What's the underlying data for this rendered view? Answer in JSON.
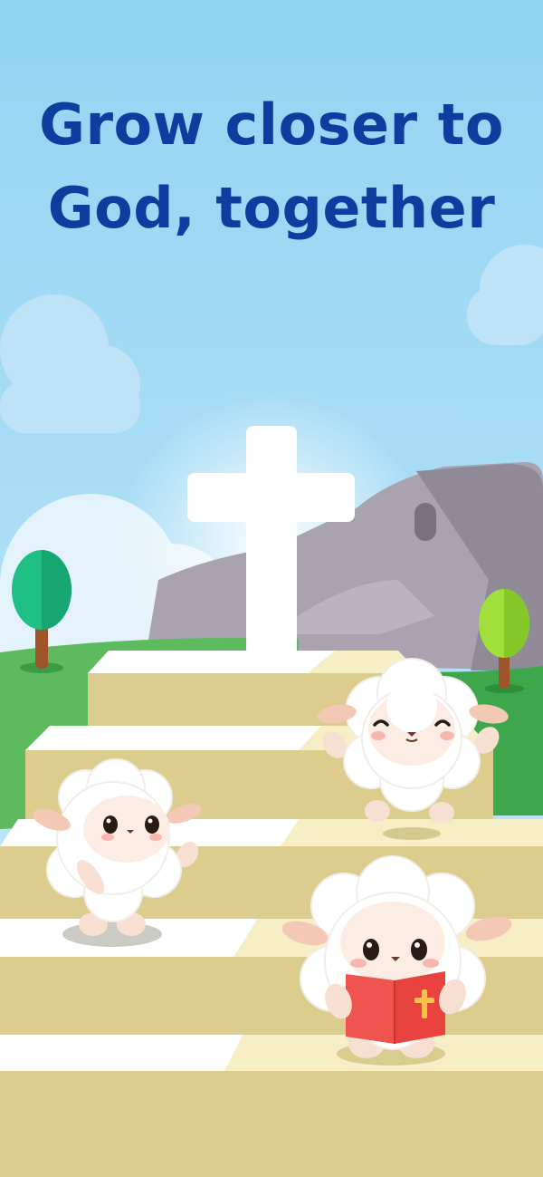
{
  "headline": {
    "line1": "Grow closer to",
    "line2": "God, together"
  },
  "colors": {
    "sky_top": "#92D4F3",
    "sky_bottom": "#CDEBFA",
    "headline": "#0D3D9E",
    "grass": "#5CB85C",
    "stairs": "#DCCC8E",
    "cross": "#FFFFFF",
    "bible": "#F0544F"
  },
  "icons": [
    "cross-icon",
    "open-bible-icon"
  ]
}
